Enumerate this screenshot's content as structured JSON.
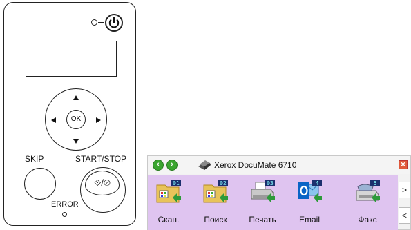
{
  "panel": {
    "ok_label": "OK",
    "skip_label": "SKIP",
    "start_stop_label": "START/STOP",
    "start_stop_symbol": "⟐/⊘",
    "error_label": "ERROR"
  },
  "window": {
    "title": "Xerox DocuMate 6710",
    "close_glyph": "✕",
    "buttons": [
      {
        "label": "Скан.",
        "number": "01",
        "icon": "folder-scan-icon"
      },
      {
        "label": "Поиск",
        "number": "02",
        "icon": "folder-search-icon"
      },
      {
        "label": "Печать",
        "number": "03",
        "icon": "printer-icon"
      },
      {
        "label": "Email",
        "number": "4",
        "icon": "outlook-email-icon"
      },
      {
        "label": "Факс",
        "number": "5",
        "icon": "fax-icon"
      }
    ],
    "scroll_right": ">",
    "scroll_left": "<"
  },
  "colors": {
    "button_bar": "#dfc4f0",
    "nav_green": "#3aa52f",
    "close_red": "#e05a3c"
  }
}
